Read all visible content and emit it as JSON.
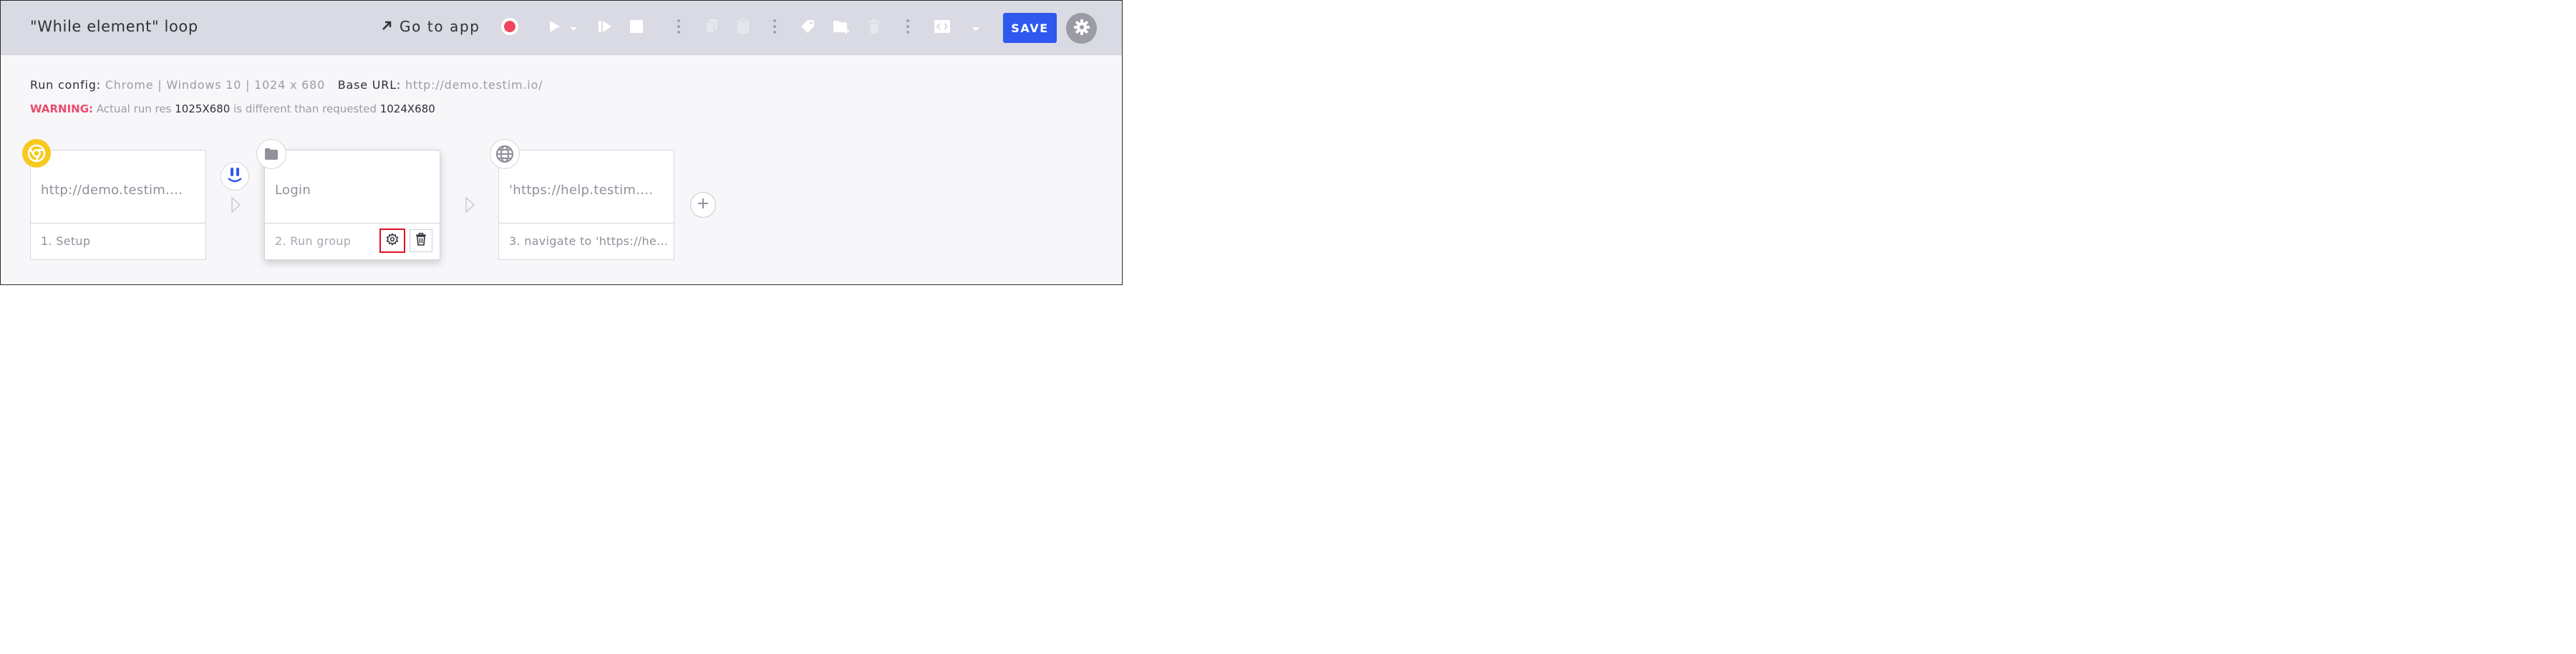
{
  "toolbar": {
    "title": "\"While element\" loop",
    "go_to_app_label": "Go to app",
    "save_label": "SAVE",
    "colors": {
      "background": "#d9dae3",
      "record": "#f0455d",
      "save": "#2f59ee"
    },
    "icons": [
      "arrow-up-right-icon",
      "record-icon",
      "play-icon",
      "dropdown-caret-icon",
      "step-forward-icon",
      "stop-icon",
      "more-vertical-icon",
      "copy-icon",
      "paste-icon",
      "more-vertical-icon",
      "tag-icon",
      "new-folder-icon",
      "delete-icon",
      "more-vertical-icon",
      "code-icon",
      "dropdown-caret-icon",
      "gear-icon"
    ]
  },
  "run_info": {
    "run_config_label": "Run config:",
    "run_config_value": "Chrome | Windows 10 | 1024 x 680",
    "base_url_label": "Base URL:",
    "base_url_value": "http://demo.testim.io/",
    "warning_label": "WARNING:",
    "warning_text_1": "Actual run res",
    "warning_actual": "1025X680",
    "warning_text_2": "is different than requested",
    "warning_requested": "1024X680",
    "warning_color": "#e94b6b"
  },
  "steps": [
    {
      "main": "http://demo.testim....",
      "sub": "1. Setup",
      "badge_icon": "chrome-icon"
    },
    {
      "main": "Login",
      "sub": "2. Run group",
      "badge_icon": "folder-icon"
    },
    {
      "main": "'https://help.testim....",
      "sub": "3. navigate to 'https://he...",
      "badge_icon": "globe-icon"
    }
  ]
}
